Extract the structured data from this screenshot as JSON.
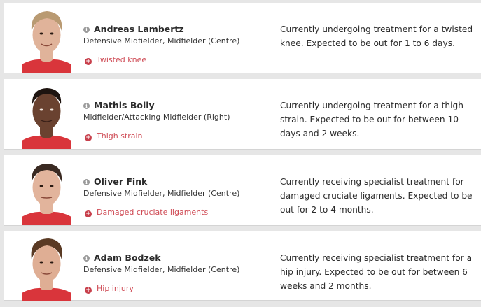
{
  "players": [
    {
      "name": "Andreas Lambertz",
      "position": "Defensive Midfielder, Midfielder (Centre)",
      "injury": "Twisted knee",
      "description": "Currently undergoing treatment for a twisted knee. Expected to be out for 1 to 6 days.",
      "skin": "#e0b39a",
      "hair": "#b99a72",
      "shirt": "#d9353b"
    },
    {
      "name": "Mathis Bolly",
      "position": "Midfielder/Attacking Midfielder (Right)",
      "injury": "Thigh strain",
      "description": "Currently undergoing treatment for a thigh strain. Expected to be out for between 10 days and 2 weeks.",
      "skin": "#6a4230",
      "hair": "#1e1410",
      "shirt": "#d9353b"
    },
    {
      "name": "Oliver Fink",
      "position": "Defensive Midfielder, Midfielder (Centre)",
      "injury": "Damaged cruciate ligaments",
      "description": "Currently receiving specialist treatment for damaged cruciate ligaments. Expected to be out for 2 to 4 months.",
      "skin": "#e2b49c",
      "hair": "#3a2a22",
      "shirt": "#d9353b"
    },
    {
      "name": "Adam Bodzek",
      "position": "Defensive Midfielder, Midfielder (Centre)",
      "injury": "Hip injury",
      "description": "Currently receiving specialist treatment for a hip injury. Expected to be out for between 6 weeks and 2 months.",
      "skin": "#dfae94",
      "hair": "#5a3a24",
      "shirt": "#d9353b"
    }
  ],
  "icons": {
    "info": "info-icon",
    "injury": "injury-cross-icon"
  },
  "colors": {
    "injury_text": "#cf4b55",
    "injury_icon": "#c8404c",
    "background": "#e6e6e6"
  }
}
